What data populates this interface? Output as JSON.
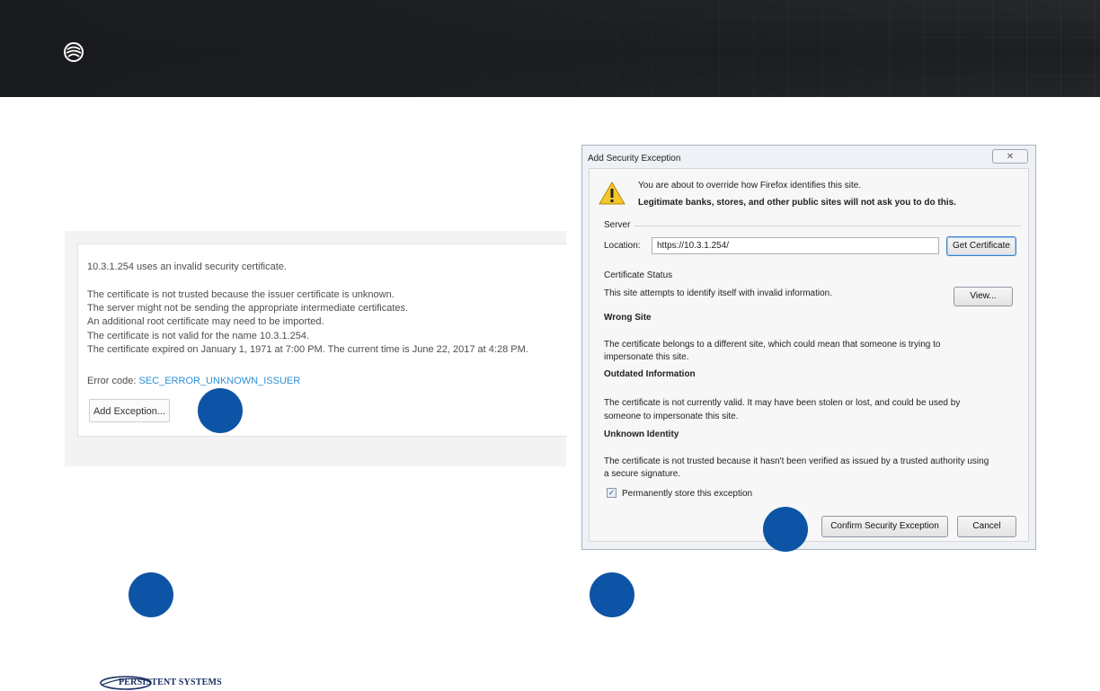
{
  "left_panel": {
    "lines": [
      "10.3.1.254 uses an invalid security certificate.",
      "The certificate is not trusted because the issuer certificate is unknown.",
      "The server might not be sending the appropriate intermediate certificates.",
      "An additional root certificate may need to be imported.",
      "The certificate is not valid for the name 10.3.1.254.",
      "The certificate expired on January 1, 1971 at 7:00 PM. The current time is June 22, 2017 at 4:28 PM."
    ],
    "error_code_label": "Error code:",
    "error_code_value": "SEC_ERROR_UNKNOWN_ISSUER",
    "add_exception_button": "Add Exception..."
  },
  "dialog": {
    "title": "Add Security Exception",
    "close_label": "✕",
    "warning_line1": "You are about to override how Firefox identifies this site.",
    "warning_line2": "Legitimate banks, stores, and other public sites will not ask you to do this.",
    "server_group": "Server",
    "location_label": "Location:",
    "location_value": "https://10.3.1.254/",
    "get_certificate_button": "Get Certificate",
    "status_group": "Certificate Status",
    "status_text": "This site attempts to identify itself with invalid information.",
    "view_button": "View...",
    "wrong_site_heading": "Wrong Site",
    "wrong_site_text1": "The certificate belongs to a different site, which could mean that someone is trying to",
    "wrong_site_text2": "impersonate this site.",
    "outdated_heading": "Outdated Information",
    "outdated_text1": "The certificate is not currently valid. It may have been stolen or lost, and could be used by",
    "outdated_text2": "someone to impersonate this site.",
    "unknown_heading": "Unknown Identity",
    "unknown_text1": "The certificate is not trusted because it hasn't been verified as issued by a trusted authority using",
    "unknown_text2": "a secure signature.",
    "permanent_checkbox_label": "Permanently store this exception",
    "permanent_checked": true,
    "confirm_button": "Confirm Security Exception",
    "cancel_button": "Cancel"
  },
  "footer": {
    "brand": "PERSISTENT SYSTEMS"
  },
  "colors": {
    "marker_blue": "#0e54a6",
    "link_blue": "#2f8fd6",
    "banner_dark": "#1d1f22"
  }
}
